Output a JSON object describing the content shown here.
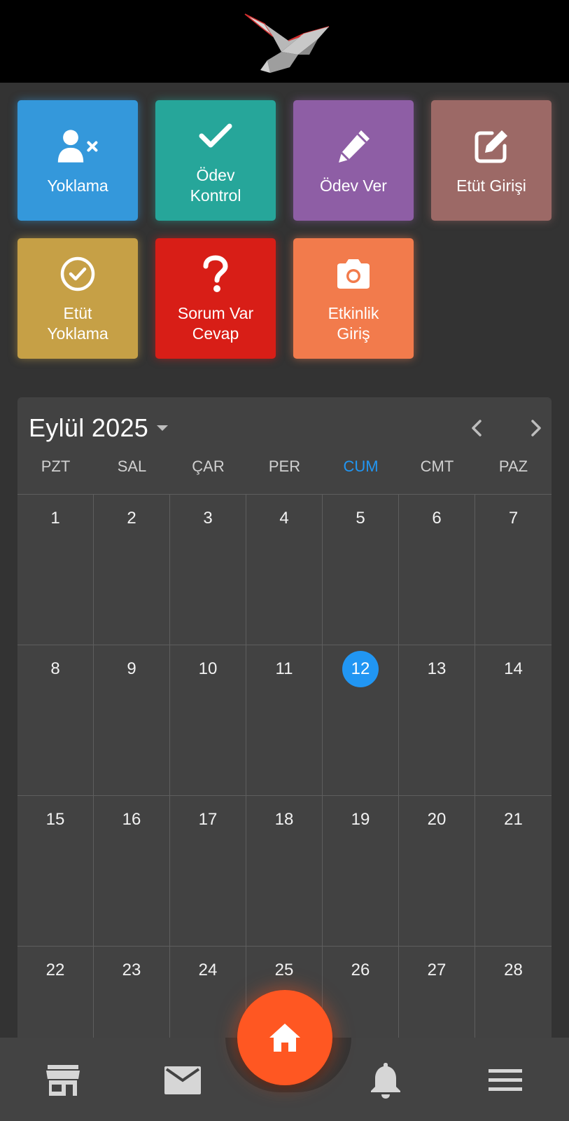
{
  "header": {
    "logo_icon": "origami-bird-logo"
  },
  "tiles": [
    {
      "label": "Yoklama",
      "icon": "user-x-icon",
      "color": "#3498db"
    },
    {
      "label": "Ödev\nKontrol",
      "icon": "check-icon",
      "color": "#26a69a"
    },
    {
      "label": "Ödev Ver",
      "icon": "pencil-icon",
      "color": "#8e5ea5"
    },
    {
      "label": "Etüt Girişi",
      "icon": "edit-square-icon",
      "color": "#9c6966"
    },
    {
      "label": "Etüt\nYoklama",
      "icon": "check-circle-icon",
      "color": "#c6a046"
    },
    {
      "label": "Sorum Var\nCevap",
      "icon": "question-icon",
      "color": "#d81e17"
    },
    {
      "label": "Etkinlik\nGiriş",
      "icon": "camera-icon",
      "color": "#f27b4c"
    }
  ],
  "calendar": {
    "month_title": "Eylül 2025",
    "weekdays": [
      "PZT",
      "SAL",
      "ÇAR",
      "PER",
      "CUM",
      "CMT",
      "PAZ"
    ],
    "today_weekday_index": 4,
    "today": "12",
    "today_color": "#2196f3",
    "weeks": [
      [
        "1",
        "2",
        "3",
        "4",
        "5",
        "6",
        "7"
      ],
      [
        "8",
        "9",
        "10",
        "11",
        "12",
        "13",
        "14"
      ],
      [
        "15",
        "16",
        "17",
        "18",
        "19",
        "20",
        "21"
      ],
      [
        "22",
        "23",
        "24",
        "25",
        "26",
        "27",
        "28"
      ]
    ]
  },
  "bottom_nav": {
    "items": [
      "store-icon",
      "mail-icon",
      "home-icon",
      "bell-icon",
      "menu-icon"
    ],
    "active": "home-icon",
    "accent": "#ff5722"
  }
}
